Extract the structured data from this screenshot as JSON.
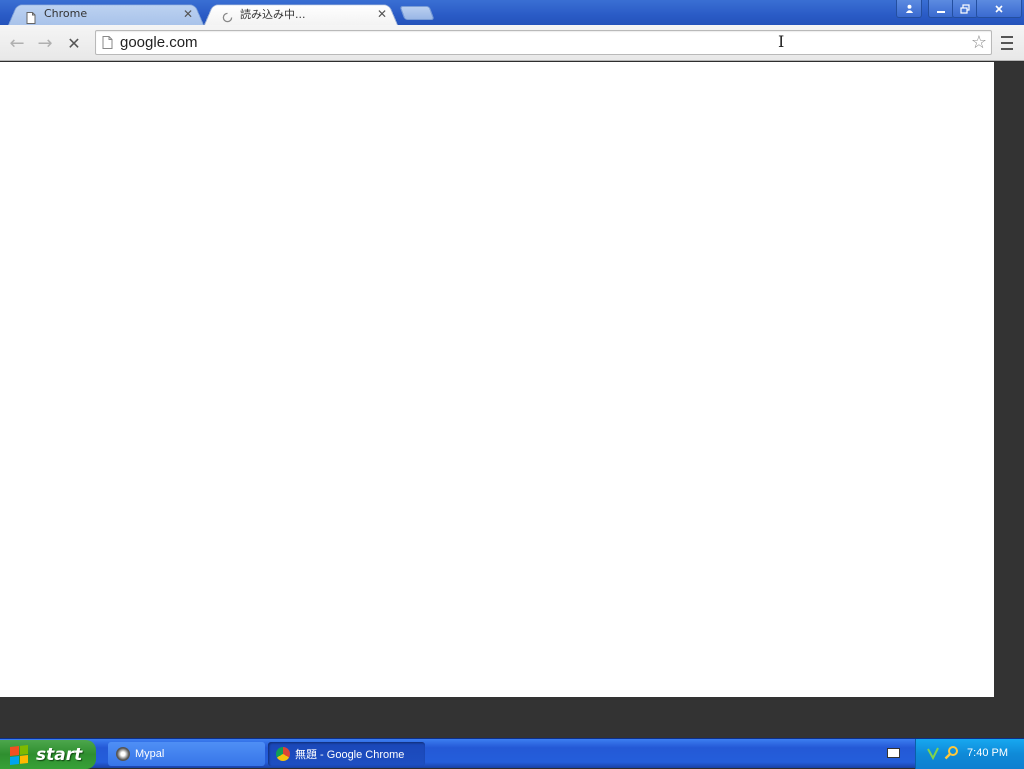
{
  "tabs": [
    {
      "label": "Chrome",
      "state": "inactive",
      "icon": "page-icon"
    },
    {
      "label": "読み込み中...",
      "state": "active",
      "icon": "loading-spinner-icon"
    }
  ],
  "window_controls": {
    "user": "user-icon",
    "minimize": "minimize-icon",
    "restore": "restore-icon",
    "close": "close-icon"
  },
  "toolbar": {
    "back": "←",
    "forward": "→",
    "stop": "✕",
    "address": "google.com",
    "star": "☆"
  },
  "taskbar": {
    "start_label": "start",
    "items": [
      {
        "label": "Mypal",
        "icon": "mypal-icon"
      },
      {
        "label": "無題 - Google Chrome",
        "icon": "chrome-icon"
      }
    ],
    "clock": "7:40 PM"
  },
  "colors": {
    "titlebar": "#2a5bc6",
    "taskbar": "#245edb",
    "start": "#2f8f2f",
    "tray": "#0f8ad8"
  }
}
